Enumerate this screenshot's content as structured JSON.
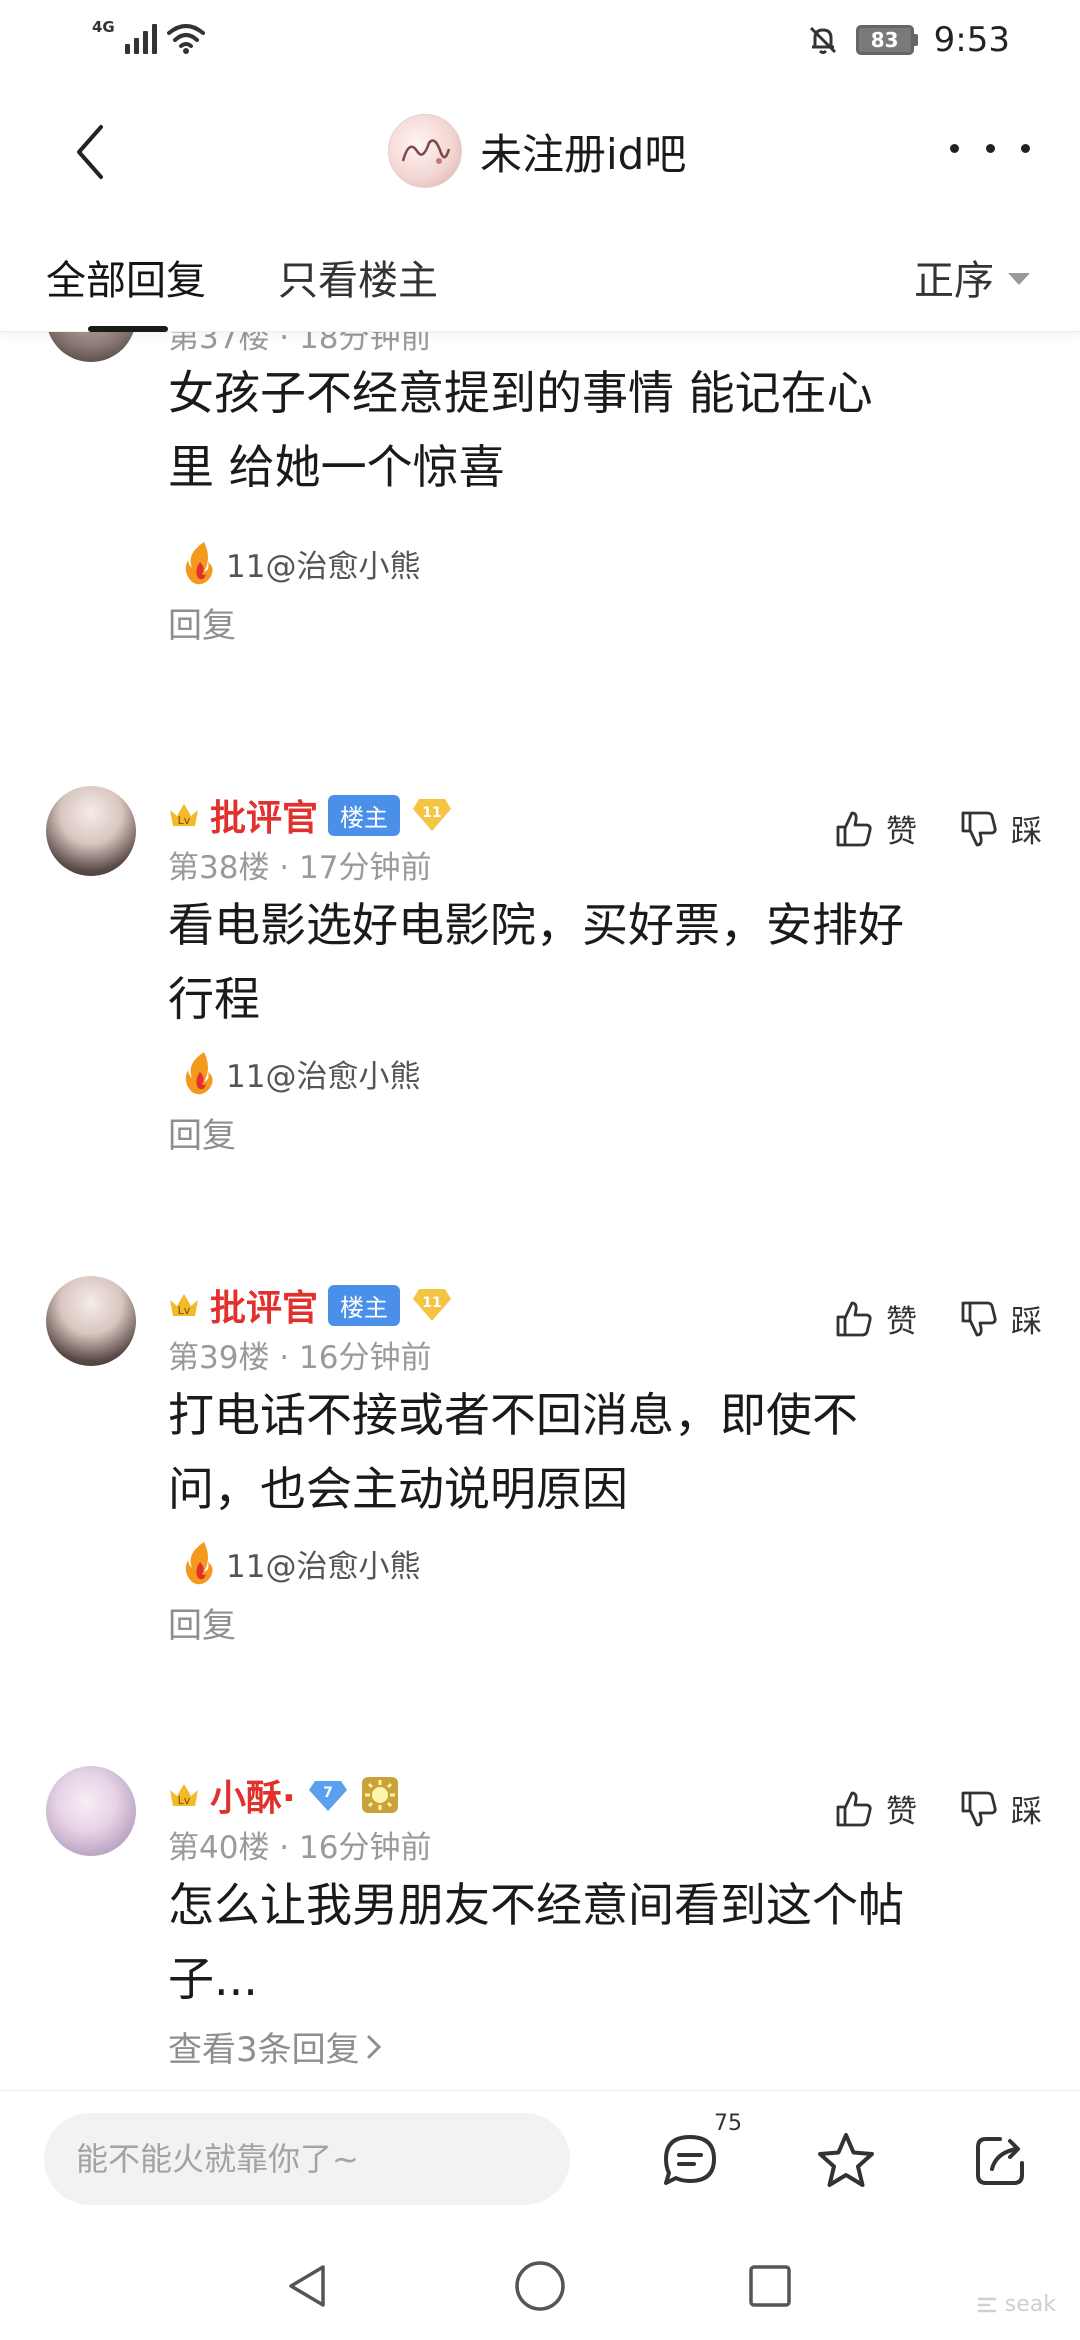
{
  "status_bar": {
    "network": "4G",
    "battery": "83",
    "time": "9:53"
  },
  "header": {
    "forum_title": "未注册id吧"
  },
  "tabs": {
    "all": "全部回复",
    "owner_only": "只看楼主",
    "sort": "正序"
  },
  "partial_post": {
    "meta": "第37楼 · 18分钟前"
  },
  "posts": [
    {
      "content_lines": [
        "女孩子不经意提到的事情 能记在心",
        "里 给她一个惊喜"
      ],
      "tail": "11@治愈小熊",
      "reply_label": "回复"
    },
    {
      "username": "批评官",
      "owner_badge": "楼主",
      "level": "11",
      "meta": "第38楼 · 17分钟前",
      "like_label": "赞",
      "dislike_label": "踩",
      "content_lines": [
        "看电影选好电影院，买好票，安排好",
        "行程"
      ],
      "tail": "11@治愈小熊",
      "reply_label": "回复"
    },
    {
      "username": "批评官",
      "owner_badge": "楼主",
      "level": "11",
      "meta": "第39楼 · 16分钟前",
      "like_label": "赞",
      "dislike_label": "踩",
      "content_lines": [
        "打电话不接或者不回消息，即使不",
        "问，也会主动说明原因"
      ],
      "tail": "11@治愈小熊",
      "reply_label": "回复"
    },
    {
      "username": "小酥·",
      "level": "7",
      "meta": "第40楼 · 16分钟前",
      "like_label": "赞",
      "dislike_label": "踩",
      "content_lines": [
        "怎么让我男朋友不经意间看到这个帖",
        "子..."
      ],
      "view_replies": "查看3条回复"
    }
  ],
  "bottom_bar": {
    "placeholder": "能不能火就靠你了~",
    "comment_count": "75"
  },
  "colors": {
    "username_red": "#e2312d",
    "owner_badge_blue": "#4a90e8",
    "meta_gray": "#9a9a9a"
  },
  "watermark": "seak"
}
